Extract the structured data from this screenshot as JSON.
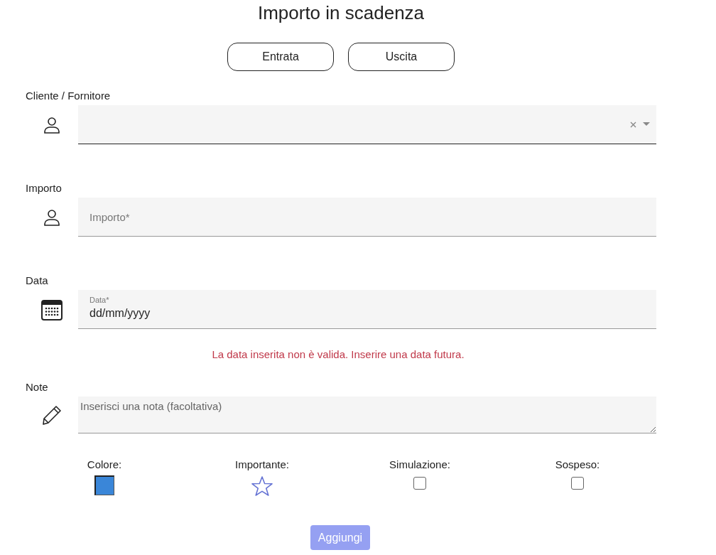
{
  "title": "Importo in scadenza",
  "type_buttons": [
    {
      "label": "Entrata"
    },
    {
      "label": "Uscita"
    }
  ],
  "fields": [
    {
      "kind": "select",
      "label": "Cliente / Fornitore"
    },
    {
      "kind": "text",
      "label": "Importo",
      "placeholder": "Importo*"
    },
    {
      "kind": "date",
      "label": "Data",
      "floating_label": "Data*",
      "value": "dd/mm/yyyy",
      "error": "La data inserita non è valida. Inserire una data futura."
    },
    {
      "kind": "textarea",
      "label": "Note",
      "placeholder": "Inserisci una nota (facoltativa)"
    }
  ],
  "options": [
    {
      "kind": "color",
      "label": "Colore:",
      "color": "#3a86d8"
    },
    {
      "kind": "star",
      "label": "Importante:",
      "checked": false
    },
    {
      "kind": "checkbox",
      "label": "Simulazione:",
      "checked": false
    },
    {
      "kind": "checkbox",
      "label": "Sospeso:",
      "checked": false
    }
  ],
  "submit": {
    "label": "Aggiungi",
    "disabled": true
  }
}
